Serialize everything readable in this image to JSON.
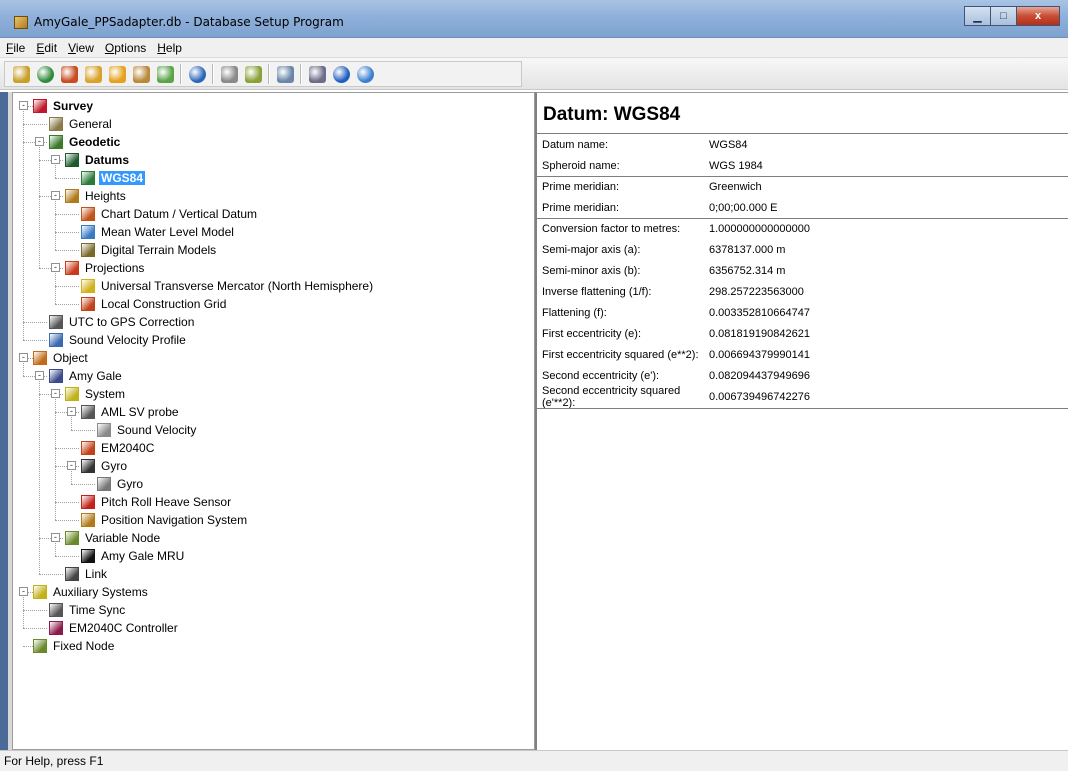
{
  "window": {
    "title": "AmyGale_PPSadapter.db - Database Setup Program"
  },
  "window_buttons": {
    "minimize": "▁",
    "maximize": "□",
    "close": "x"
  },
  "menu": [
    "File",
    "Edit",
    "View",
    "Options",
    "Help"
  ],
  "toolbar": [
    {
      "name": "checklist-icon",
      "color": "#c9a02a"
    },
    {
      "name": "globe-icon",
      "color": "#2f8a3c"
    },
    {
      "name": "ship-icon",
      "color": "#c94c22"
    },
    {
      "name": "magic-wand-icon",
      "color": "#d9a22a"
    },
    {
      "name": "add-sensor-icon",
      "color": "#e6a21e"
    },
    {
      "name": "vessel-icon",
      "color": "#b98a3a"
    },
    {
      "name": "link-icon",
      "color": "#5ba44a"
    },
    "sep",
    {
      "name": "globe-grid-icon",
      "color": "#2a66b8"
    },
    "sep",
    {
      "name": "satellite-icon",
      "color": "#8a8a8a"
    },
    {
      "name": "pencil-icon",
      "color": "#8aa23a"
    },
    "sep",
    {
      "name": "print-preview-icon",
      "color": "#6a86a8"
    },
    "sep",
    {
      "name": "print-icon",
      "color": "#6d6d8a"
    },
    {
      "name": "info-icon",
      "color": "#1f5fbf"
    },
    {
      "name": "help-icon",
      "color": "#3b7fd1"
    }
  ],
  "tree": [
    {
      "label": "Survey",
      "level": 0,
      "bold": true,
      "expander": "-",
      "icon": "survey-icon",
      "color": "#c0182a"
    },
    {
      "label": "General",
      "level": 1,
      "icon": "general-icon",
      "color": "#8a7a4a"
    },
    {
      "label": "Geodetic",
      "level": 1,
      "bold": true,
      "expander": "-",
      "icon": "geodetic-icon",
      "color": "#3a7a2a"
    },
    {
      "label": "Datums",
      "level": 2,
      "bold": true,
      "expander": "-",
      "icon": "datums-icon",
      "color": "#1a5a2a"
    },
    {
      "label": "WGS84",
      "level": 3,
      "bold": true,
      "selected": true,
      "icon": "wgs84-icon",
      "color": "#2a7a3a"
    },
    {
      "label": "Heights",
      "level": 2,
      "expander": "-",
      "icon": "heights-icon",
      "color": "#b07a1a"
    },
    {
      "label": "Chart Datum / Vertical Datum",
      "level": 3,
      "icon": "chart-datum-icon",
      "color": "#c2521a"
    },
    {
      "label": "Mean Water Level Model",
      "level": 3,
      "icon": "water-level-icon",
      "color": "#3a7ac2"
    },
    {
      "label": "Digital Terrain Models",
      "level": 3,
      "icon": "terrain-icon",
      "color": "#7a6a2a"
    },
    {
      "label": "Projections",
      "level": 2,
      "expander": "-",
      "icon": "projections-icon",
      "color": "#c93a1a"
    },
    {
      "label": "Universal Transverse Mercator (North Hemisphere)",
      "level": 3,
      "icon": "utm-icon",
      "color": "#d2b21a"
    },
    {
      "label": "Local Construction Grid",
      "level": 3,
      "icon": "grid-icon",
      "color": "#c2421a"
    },
    {
      "label": "UTC to GPS Correction",
      "level": 1,
      "icon": "clock-icon",
      "color": "#555555"
    },
    {
      "label": "Sound Velocity Profile",
      "level": 1,
      "icon": "svp-icon",
      "color": "#3a6ab2"
    },
    {
      "label": "Object",
      "level": 0,
      "expander": "-",
      "icon": "object-icon",
      "color": "#c26a1a"
    },
    {
      "label": "Amy Gale",
      "level": 1,
      "expander": "-",
      "icon": "vessel-icon",
      "color": "#3a4a8a"
    },
    {
      "label": "System",
      "level": 2,
      "expander": "-",
      "icon": "system-icon",
      "color": "#c2b21a"
    },
    {
      "label": "AML SV probe",
      "level": 3,
      "expander": "-",
      "icon": "probe-icon",
      "color": "#555555"
    },
    {
      "label": "Sound Velocity",
      "level": 4,
      "icon": "sound-velocity-icon",
      "color": "#8a8a8a"
    },
    {
      "label": "EM2040C",
      "level": 3,
      "icon": "echosounder-icon",
      "color": "#c2421a"
    },
    {
      "label": "Gyro",
      "level": 3,
      "expander": "-",
      "icon": "gyro-icon",
      "color": "#333333"
    },
    {
      "label": "Gyro",
      "level": 4,
      "icon": "gyro-data-icon",
      "color": "#777777"
    },
    {
      "label": "Pitch Roll Heave Sensor",
      "level": 3,
      "icon": "motion-sensor-icon",
      "color": "#c2221a"
    },
    {
      "label": "Position Navigation System",
      "level": 3,
      "icon": "navigation-icon",
      "color": "#b07a1a"
    },
    {
      "label": "Variable Node",
      "level": 2,
      "expander": "-",
      "icon": "node-icon",
      "color": "#6a8a2a"
    },
    {
      "label": "Amy Gale MRU",
      "level": 3,
      "icon": "mru-icon",
      "color": "#111111"
    },
    {
      "label": "Link",
      "level": 2,
      "icon": "link-icon",
      "color": "#444444"
    },
    {
      "label": "Auxiliary Systems",
      "level": 0,
      "expander": "-",
      "icon": "aux-icon",
      "color": "#c2b21a"
    },
    {
      "label": "Time Sync",
      "level": 1,
      "icon": "clock-icon",
      "color": "#555555"
    },
    {
      "label": "EM2040C Controller",
      "level": 1,
      "icon": "controller-icon",
      "color": "#8a1a4a"
    },
    {
      "label": "Fixed Node",
      "level": 0,
      "icon": "node-icon",
      "color": "#6a8a2a"
    }
  ],
  "detail": {
    "heading": "Datum: WGS84",
    "groups": [
      [
        {
          "label": "Datum name:",
          "value": "WGS84"
        },
        {
          "label": "Spheroid name:",
          "value": "WGS 1984"
        }
      ],
      [
        {
          "label": "Prime meridian:",
          "value": "Greenwich"
        },
        {
          "label": "Prime meridian:",
          "value": "0;00;00.000 E"
        }
      ],
      [
        {
          "label": "Conversion factor to metres:",
          "value": "1.000000000000000"
        },
        {
          "label": "Semi-major axis (a):",
          "value": "6378137.000 m"
        },
        {
          "label": "Semi-minor axis (b):",
          "value": "6356752.314 m"
        },
        {
          "label": "Inverse flattening (1/f):",
          "value": "298.257223563000"
        },
        {
          "label": "Flattening (f):",
          "value": "0.003352810664747"
        },
        {
          "label": "First eccentricity (e):",
          "value": "0.081819190842621"
        },
        {
          "label": "First eccentricity squared (e**2):",
          "value": "0.006694379990141"
        },
        {
          "label": "Second eccentricity (e'):",
          "value": "0.082094437949696"
        },
        {
          "label": "Second eccentricity squared (e'**2):",
          "value": "0.006739496742276"
        }
      ]
    ]
  },
  "status": {
    "text": "For Help, press F1"
  }
}
